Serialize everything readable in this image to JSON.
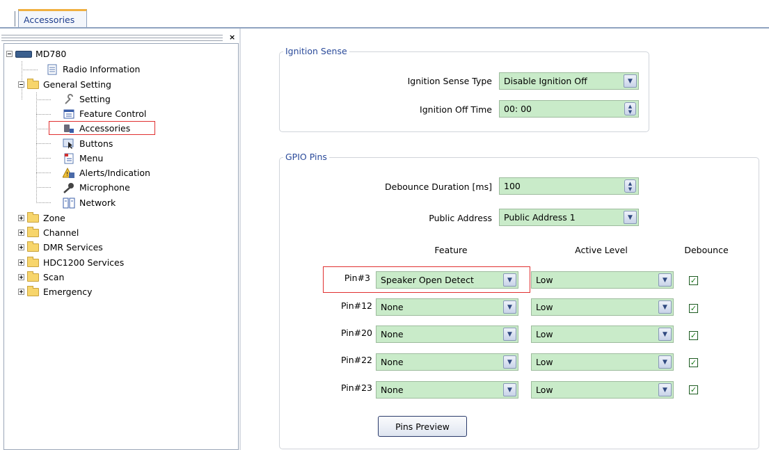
{
  "tabs": [
    {
      "label": "Accessories"
    }
  ],
  "tree": {
    "root": "MD780",
    "items": [
      {
        "label": "Radio Information",
        "icon": "document-icon"
      },
      {
        "label": "General Setting",
        "icon": "folder-icon"
      },
      {
        "label": "Setting",
        "icon": "wrench-icon"
      },
      {
        "label": "Feature Control",
        "icon": "list-icon"
      },
      {
        "label": "Accessories",
        "icon": "accessories-icon"
      },
      {
        "label": "Buttons",
        "icon": "cursor-icon"
      },
      {
        "label": "Menu",
        "icon": "menu-icon"
      },
      {
        "label": "Alerts/Indication",
        "icon": "alert-icon"
      },
      {
        "label": "Microphone",
        "icon": "microphone-icon"
      },
      {
        "label": "Network",
        "icon": "network-icon"
      },
      {
        "label": "Zone",
        "icon": "folder-icon"
      },
      {
        "label": "Channel",
        "icon": "folder-icon"
      },
      {
        "label": "DMR Services",
        "icon": "folder-icon"
      },
      {
        "label": "HDC1200 Services",
        "icon": "folder-icon"
      },
      {
        "label": "Scan",
        "icon": "folder-icon"
      },
      {
        "label": "Emergency",
        "icon": "folder-icon"
      }
    ],
    "close_glyph": "×"
  },
  "ignition": {
    "title": "Ignition Sense",
    "type_label": "Ignition Sense Type",
    "type_value": "Disable Ignition Off",
    "off_time_label": "Ignition Off Time",
    "off_time_value": "00: 00"
  },
  "gpio": {
    "title": "GPIO Pins",
    "debounce_label": "Debounce Duration [ms]",
    "debounce_value": "100",
    "public_address_label": "Public Address",
    "public_address_value": "Public Address 1",
    "headers": {
      "feature": "Feature",
      "active_level": "Active Level",
      "debounce": "Debounce"
    },
    "pins": [
      {
        "label": "Pin#3",
        "feature": "Speaker Open Detect",
        "level": "Low",
        "debounce": true
      },
      {
        "label": "Pin#12",
        "feature": "None",
        "level": "Low",
        "debounce": true
      },
      {
        "label": "Pin#20",
        "feature": "None",
        "level": "Low",
        "debounce": true
      },
      {
        "label": "Pin#22",
        "feature": "None",
        "level": "Low",
        "debounce": true
      },
      {
        "label": "Pin#23",
        "feature": "None",
        "level": "Low",
        "debounce": true
      }
    ],
    "preview_button": "Pins Preview"
  },
  "colors": {
    "field_bg": "#c9ebc9",
    "highlight": "#e03030",
    "group_title": "#2a4a9a",
    "tab_accent": "#f0b040"
  },
  "glyphs": {
    "check": "✓",
    "dropdown": "▼",
    "spin_up": "▲",
    "spin_down": "▼"
  }
}
